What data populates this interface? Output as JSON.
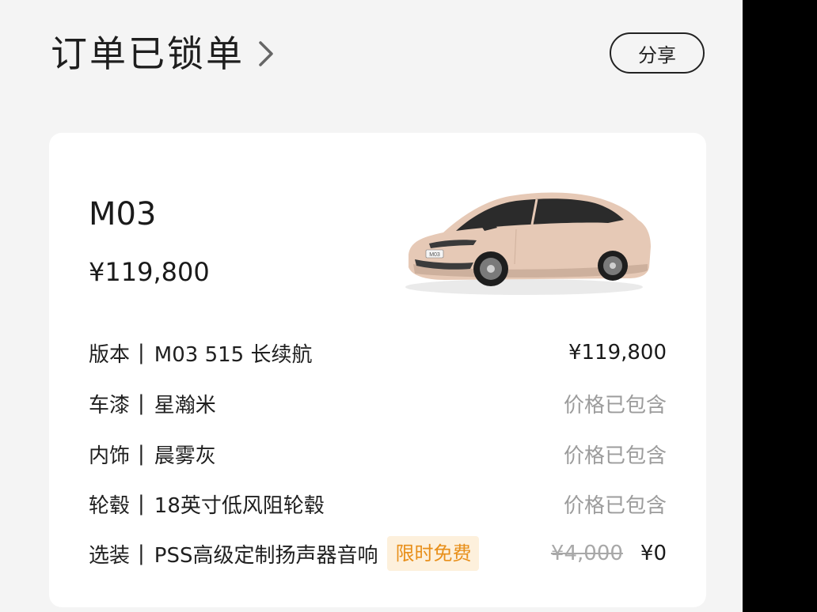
{
  "header": {
    "title": "订单已锁单",
    "chevron_icon": "chevron-right-icon",
    "share_label": "分享"
  },
  "car": {
    "model": "M03",
    "price": "¥119,800",
    "image_icon": "car-image",
    "badge_text": "M03",
    "paint_color": "#e6c9b6"
  },
  "specs": [
    {
      "label": "版本",
      "separator": "|",
      "value": "M03 515 长续航",
      "right": "¥119,800"
    },
    {
      "label": "车漆",
      "separator": "|",
      "value": "星瀚米",
      "right": "价格已包含"
    },
    {
      "label": "内饰",
      "separator": "|",
      "value": "晨雾灰",
      "right": "价格已包含"
    },
    {
      "label": "轮毂",
      "separator": "|",
      "value": "18英寸低风阻轮毂",
      "right": "价格已包含"
    }
  ],
  "option": {
    "label": "选装",
    "separator": "|",
    "value": "PSS高级定制扬声器音响",
    "badge": "限时免费",
    "old_price": "¥4,000",
    "new_price": "¥0"
  },
  "colors": {
    "background": "#f4f4f4",
    "card": "#ffffff",
    "muted_text": "#9c9c9c",
    "promo_text": "#e88f1a",
    "promo_bg": "#fdf0dc"
  }
}
